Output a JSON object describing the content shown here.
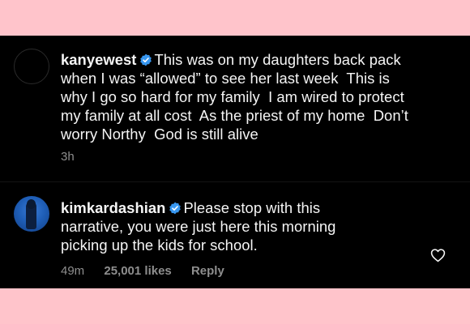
{
  "comments": [
    {
      "username": "kanyewest",
      "verified": true,
      "text_lines": [
        "This was on my daughters back pack",
        "when I was “allowed” to see her last week  This is",
        "why I go so hard for my family  I am wired to protect",
        "my family at all cost  As the priest of my home  Don’t",
        "worry Northy  God is still alive"
      ],
      "time": "3h"
    },
    {
      "username": "kimkardashian",
      "verified": true,
      "text_lines": [
        "Please stop with this",
        "narrative, you were just here this morning",
        "picking up the kids for school."
      ],
      "time": "49m",
      "likes": "25,001 likes",
      "reply_label": "Reply",
      "like_icon": "heart-outline-icon"
    }
  ],
  "colors": {
    "background_frame": "#ffc4cb",
    "panel": "#000000",
    "text": "#f5f5f5",
    "meta": "#8e8e8e",
    "verified_badge": "#3897f0"
  }
}
